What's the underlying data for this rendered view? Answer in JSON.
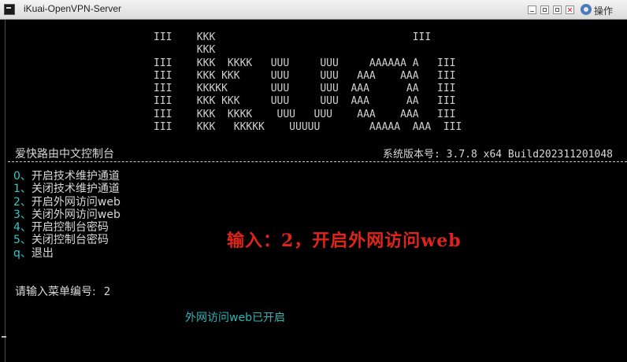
{
  "window": {
    "title": "iKuai-OpenVPN-Server",
    "action_label": "操作",
    "icons": [
      "app-icon",
      "minimize-icon",
      "maximize-icon",
      "close-icon",
      "gear-icon"
    ]
  },
  "banner": {
    "lines": [
      "III    KKK                                III",
      "       KKK",
      "III    KKK  KKKK   UUU     UUU     AAAAAA A   III",
      "III    KKK KKK     UUU     UUU   AAA    AAA   III",
      "III    KKKKK       UUU     UUU  AAA      AA   III",
      "III    KKK KKK     UUU     UUU  AAA      AA   III",
      "III    KKK  KKKK    UUU   UUU    AAA    AAA   III",
      "III    KKK   KKKKK    UUUUU        AAAAA  AAA  III"
    ]
  },
  "header": {
    "console_name": "爱快路由中文控制台",
    "version": "系统版本号: 3.7.8 x64 Build202311201048"
  },
  "menu": [
    {
      "key": "0",
      "sep": "、",
      "label": "开启技术维护通道"
    },
    {
      "key": "1",
      "sep": "、",
      "label": "关闭技术维护通道"
    },
    {
      "key": "2",
      "sep": "、",
      "label": "开启外网访问web"
    },
    {
      "key": "3",
      "sep": "、",
      "label": "关闭外网访问web"
    },
    {
      "key": "4",
      "sep": "、",
      "label": "开启控制台密码"
    },
    {
      "key": "5",
      "sep": "、",
      "label": "关闭控制台密码"
    },
    {
      "key": "q",
      "sep": "、",
      "label": "退出"
    }
  ],
  "prompt": {
    "label": "请输入菜单编号:",
    "value": "2"
  },
  "result": "外网访问web已开启",
  "annotation": "输入：2，开启外网访问web",
  "colors": {
    "background": "#000000",
    "text": "#d8d8d8",
    "accent": "#33c7c7",
    "annotation": "#e0241c"
  }
}
